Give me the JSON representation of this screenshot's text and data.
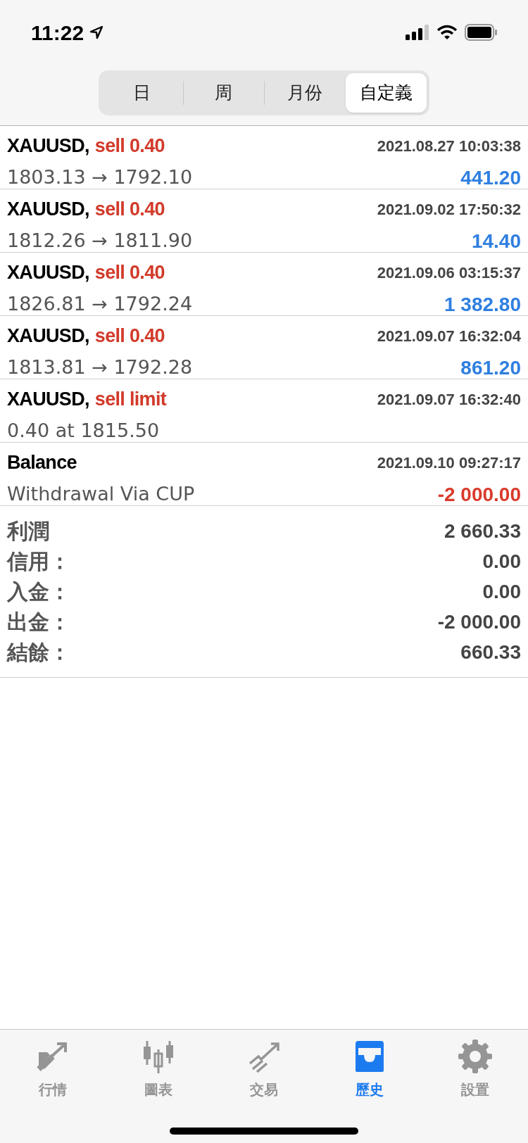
{
  "status_bar": {
    "time": "11:22"
  },
  "period_tabs": [
    {
      "label": "日",
      "selected": false
    },
    {
      "label": "周",
      "selected": false
    },
    {
      "label": "月份",
      "selected": false
    },
    {
      "label": "自定義",
      "selected": true
    }
  ],
  "history": [
    {
      "symbol": "XAUUSD,",
      "action": "sell 0.40",
      "time": "2021.08.27 10:03:38",
      "detail": "1803.13 → 1792.10",
      "profit": "441.20",
      "color": "#2f7fe0"
    },
    {
      "symbol": "XAUUSD,",
      "action": "sell 0.40",
      "time": "2021.09.02 17:50:32",
      "detail": "1812.26 → 1811.90",
      "profit": "14.40",
      "color": "#2f7fe0"
    },
    {
      "symbol": "XAUUSD,",
      "action": "sell 0.40",
      "time": "2021.09.06 03:15:37",
      "detail": "1826.81 → 1792.24",
      "profit": "1 382.80",
      "color": "#2f7fe0"
    },
    {
      "symbol": "XAUUSD,",
      "action": "sell 0.40",
      "time": "2021.09.07 16:32:04",
      "detail": "1813.81 → 1792.28",
      "profit": "861.20",
      "color": "#2f7fe0"
    },
    {
      "symbol": "XAUUSD,",
      "action": "sell limit",
      "time": "2021.09.07 16:32:40",
      "detail": "0.40 at 1815.50"
    },
    {
      "symbol": "Balance",
      "time": "2021.09.10 09:27:17",
      "detail": "Withdrawal Via CUP",
      "profit": "-2 000.00",
      "color": "#d93a2b"
    }
  ],
  "summary": [
    {
      "label": "利潤",
      "value": "2 660.33"
    },
    {
      "label": "信用：",
      "value": "0.00"
    },
    {
      "label": "入金：",
      "value": "0.00"
    },
    {
      "label": "出金：",
      "value": "-2 000.00"
    },
    {
      "label": "結餘：",
      "value": "660.33"
    }
  ],
  "tab_bar": [
    {
      "label": "行情",
      "selected": false
    },
    {
      "label": "圖表",
      "selected": false
    },
    {
      "label": "交易",
      "selected": false
    },
    {
      "label": "歷史",
      "selected": true
    },
    {
      "label": "設置",
      "selected": false
    }
  ]
}
